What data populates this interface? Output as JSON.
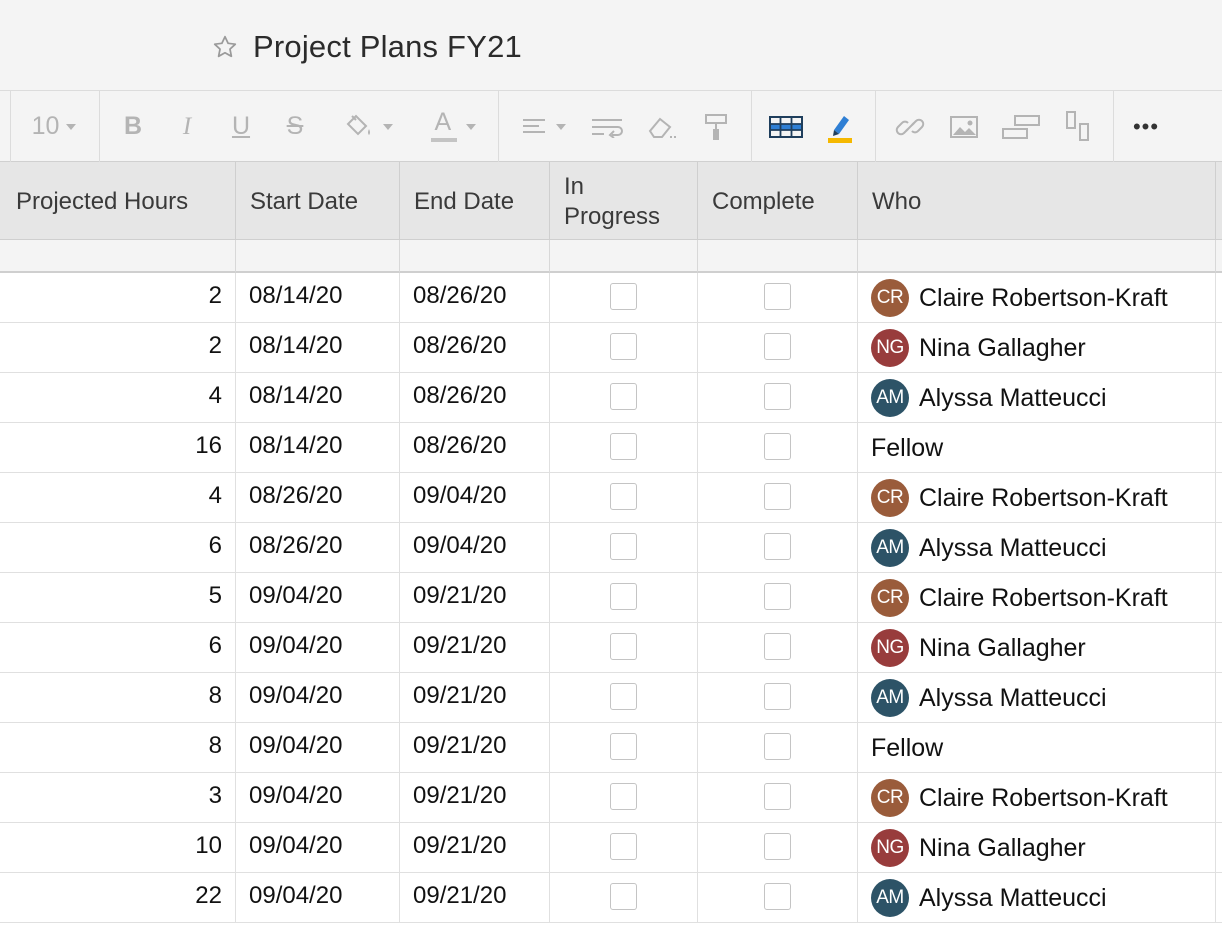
{
  "sheet": {
    "title": "Project Plans FY21"
  },
  "toolbar": {
    "font_size": "10",
    "items": [
      {
        "name": "bold",
        "glyph": "B"
      },
      {
        "name": "italic",
        "glyph": "I"
      },
      {
        "name": "underline",
        "glyph": "U"
      },
      {
        "name": "strikethrough",
        "glyph": "S"
      },
      {
        "name": "text-color",
        "glyph": "A"
      }
    ],
    "more_glyph": "•••"
  },
  "columns": [
    "Projected Hours",
    "Start Date",
    "End Date",
    "In Progress",
    "Complete",
    "Who"
  ],
  "column_in_progress": [
    "In",
    "Progress"
  ],
  "avatar_colors": {
    "CR": "#9a5c3b",
    "NG": "#983c3c",
    "AM": "#2d5367"
  },
  "rows": [
    {
      "hours": "2",
      "start": "08/14/20",
      "end": "08/26/20",
      "initials": "CR",
      "who": "Claire Robertson-Kraft"
    },
    {
      "hours": "2",
      "start": "08/14/20",
      "end": "08/26/20",
      "initials": "NG",
      "who": "Nina Gallagher"
    },
    {
      "hours": "4",
      "start": "08/14/20",
      "end": "08/26/20",
      "initials": "AM",
      "who": "Alyssa Matteucci"
    },
    {
      "hours": "16",
      "start": "08/14/20",
      "end": "08/26/20",
      "initials": "",
      "who": "Fellow"
    },
    {
      "hours": "4",
      "start": "08/26/20",
      "end": "09/04/20",
      "initials": "CR",
      "who": "Claire Robertson-Kraft"
    },
    {
      "hours": "6",
      "start": "08/26/20",
      "end": "09/04/20",
      "initials": "AM",
      "who": "Alyssa Matteucci"
    },
    {
      "hours": "5",
      "start": "09/04/20",
      "end": "09/21/20",
      "initials": "CR",
      "who": "Claire Robertson-Kraft"
    },
    {
      "hours": "6",
      "start": "09/04/20",
      "end": "09/21/20",
      "initials": "NG",
      "who": "Nina Gallagher"
    },
    {
      "hours": "8",
      "start": "09/04/20",
      "end": "09/21/20",
      "initials": "AM",
      "who": "Alyssa Matteucci"
    },
    {
      "hours": "8",
      "start": "09/04/20",
      "end": "09/21/20",
      "initials": "",
      "who": "Fellow"
    },
    {
      "hours": "3",
      "start": "09/04/20",
      "end": "09/21/20",
      "initials": "CR",
      "who": "Claire Robertson-Kraft"
    },
    {
      "hours": "10",
      "start": "09/04/20",
      "end": "09/21/20",
      "initials": "NG",
      "who": "Nina Gallagher"
    },
    {
      "hours": "22",
      "start": "09/04/20",
      "end": "09/21/20",
      "initials": "AM",
      "who": "Alyssa Matteucci"
    }
  ]
}
